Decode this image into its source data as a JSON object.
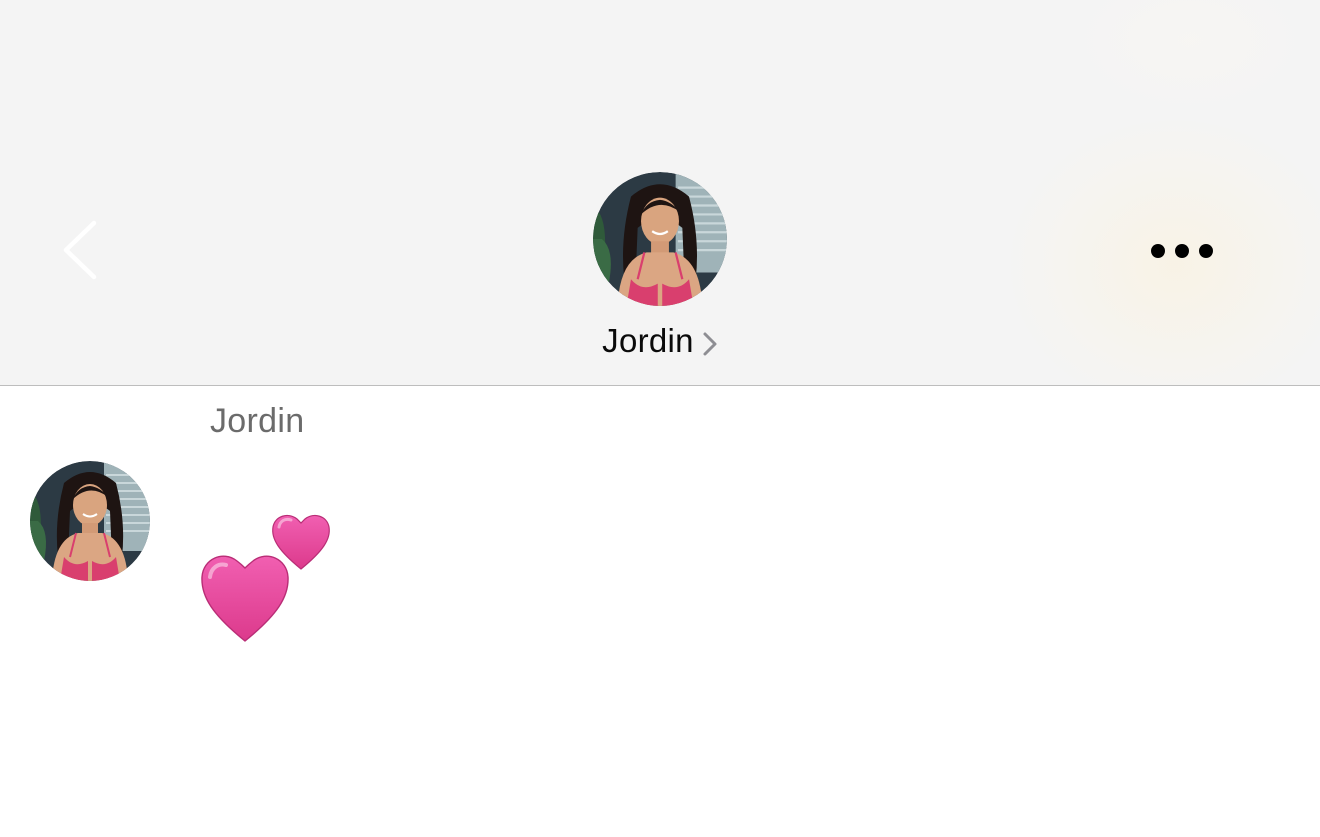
{
  "header": {
    "contact_name": "Jordin",
    "back_icon": "chevron-left-icon",
    "more_icon": "ellipsis-icon",
    "name_chevron_icon": "chevron-right-icon",
    "background_color": "#f4f4f4",
    "divider_color": "#bdbdbd"
  },
  "conversation": {
    "messages": [
      {
        "sender_name": "Jordin",
        "avatar": "contact-avatar-photo",
        "content_emoji": "two-hearts-emoji",
        "emoji_color": "#e8439a"
      }
    ]
  }
}
